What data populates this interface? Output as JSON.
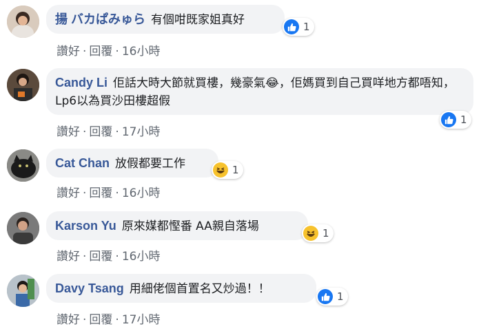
{
  "comments": [
    {
      "author": "揚 バカぱみゅら",
      "text": "有個咁既家姐真好",
      "reaction_type": "like-icon",
      "reaction_count": "1",
      "like_label": "讚好",
      "reply_label": "回覆",
      "time": "16小時"
    },
    {
      "author": "Candy Li",
      "text": "佢話大時大節就買樓，幾豪氣😂，佢媽買到自己買咩地方都唔知，Lp6以為買沙田樓超假",
      "reaction_type": "like-icon",
      "reaction_count": "1",
      "like_label": "讚好",
      "reply_label": "回覆",
      "time": "17小時"
    },
    {
      "author": "Cat Chan",
      "text": "放假都要工作",
      "reaction_type": "haha-icon",
      "reaction_count": "1",
      "like_label": "讚好",
      "reply_label": "回覆",
      "time": "16小時"
    },
    {
      "author": "Karson Yu",
      "text": "原來媒都慳番 AA親自落場",
      "reaction_type": "haha-icon",
      "reaction_count": "1",
      "like_label": "讚好",
      "reply_label": "回覆",
      "time": "16小時"
    },
    {
      "author": "Davy Tsang",
      "text": "用細佬個首置名又炒過！！",
      "reaction_type": "like-icon",
      "reaction_count": "1",
      "like_label": "讚好",
      "reply_label": "回覆",
      "time": "17小時"
    }
  ],
  "colors": {
    "author": "#385898",
    "bubble": "#f2f3f5",
    "like": "#1877f2",
    "haha": "#f7c22d"
  }
}
